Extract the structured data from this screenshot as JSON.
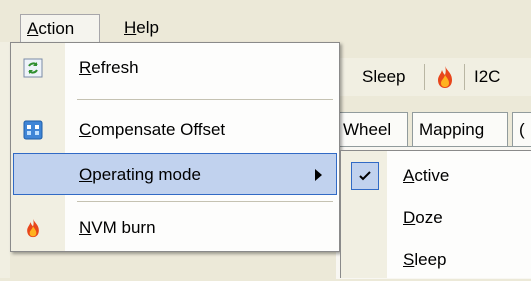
{
  "menubar": {
    "items": [
      {
        "label": "Action",
        "accel": "A",
        "rest": "ction",
        "active": true
      },
      {
        "label": "Help",
        "accel": "H",
        "rest": "elp",
        "active": false
      }
    ]
  },
  "toolbar": {
    "sleep_label": "Sleep",
    "i2c_label": "I2C"
  },
  "tabs": [
    "Wheel",
    "Mapping",
    "("
  ],
  "action_menu": {
    "items": [
      {
        "label": "Refresh",
        "accel": "R",
        "rest": "efresh",
        "icon": "refresh-icon"
      },
      {
        "label": "Compensate Offset",
        "accel": "C",
        "rest": "ompensate Offset",
        "icon": "compensate-icon"
      },
      {
        "label": "Operating mode",
        "accel": "O",
        "rest": "perating mode",
        "icon": "",
        "has_submenu": true
      },
      {
        "label": "NVM burn",
        "accel": "N",
        "rest": "VM burn",
        "icon": "fire-icon"
      }
    ]
  },
  "operating_mode_submenu": {
    "items": [
      {
        "label": "Active",
        "accel": "A",
        "rest": "ctive",
        "checked": true
      },
      {
        "label": "Doze",
        "accel": "D",
        "rest": "oze",
        "checked": false
      },
      {
        "label": "Sleep",
        "accel": "S",
        "rest": "leep",
        "checked": false
      }
    ]
  },
  "colors": {
    "highlight": "#c1d2ee",
    "highlight_border": "#316ac5",
    "gutter": "#f1efe2"
  }
}
